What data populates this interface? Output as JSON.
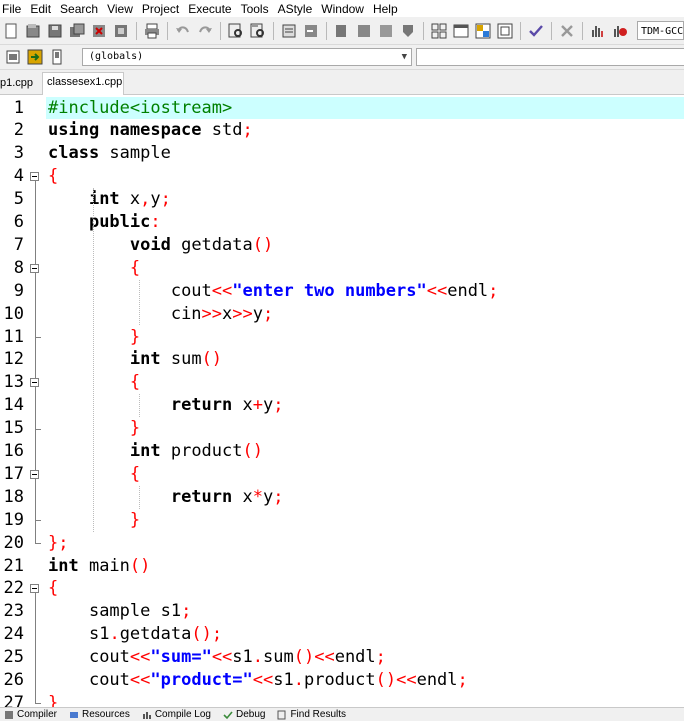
{
  "menubar": {
    "items": [
      "File",
      "Edit",
      "Search",
      "View",
      "Project",
      "Execute",
      "Tools",
      "AStyle",
      "Window",
      "Help"
    ]
  },
  "toolbar": {
    "compiler_label": "TDM-GCC"
  },
  "toolbar2": {
    "scope_value": "(globals)"
  },
  "tabs": [
    {
      "label": "p1.cpp"
    },
    {
      "label": "classesex1.cpp"
    }
  ],
  "editor": {
    "line_numbers": [
      "1",
      "2",
      "3",
      "4",
      "5",
      "6",
      "7",
      "8",
      "9",
      "10",
      "11",
      "12",
      "13",
      "14",
      "15",
      "16",
      "17",
      "18",
      "19",
      "20",
      "21",
      "22",
      "23",
      "24",
      "25",
      "26",
      "27"
    ],
    "lines": [
      [
        {
          "t": "#include<iostream>",
          "c": "pp"
        }
      ],
      [
        {
          "t": "using namespace ",
          "c": "kw"
        },
        {
          "t": "std",
          "c": "plain"
        },
        {
          "t": ";",
          "c": "sym"
        }
      ],
      [
        {
          "t": "class ",
          "c": "kw"
        },
        {
          "t": "sample",
          "c": "plain"
        }
      ],
      [
        {
          "t": "{",
          "c": "sym"
        }
      ],
      [
        {
          "t": "    ",
          "c": "plain"
        },
        {
          "t": "int ",
          "c": "kw"
        },
        {
          "t": "x",
          "c": "plain"
        },
        {
          "t": ",",
          "c": "sym"
        },
        {
          "t": "y",
          "c": "plain"
        },
        {
          "t": ";",
          "c": "sym"
        }
      ],
      [
        {
          "t": "    ",
          "c": "plain"
        },
        {
          "t": "public",
          "c": "kw"
        },
        {
          "t": ":",
          "c": "sym"
        }
      ],
      [
        {
          "t": "        ",
          "c": "plain"
        },
        {
          "t": "void ",
          "c": "kw"
        },
        {
          "t": "getdata",
          "c": "plain"
        },
        {
          "t": "()",
          "c": "sym"
        }
      ],
      [
        {
          "t": "        ",
          "c": "plain"
        },
        {
          "t": "{",
          "c": "sym"
        }
      ],
      [
        {
          "t": "            ",
          "c": "plain"
        },
        {
          "t": "cout",
          "c": "plain"
        },
        {
          "t": "<<",
          "c": "sym"
        },
        {
          "t": "\"enter two numbers\"",
          "c": "str"
        },
        {
          "t": "<<",
          "c": "sym"
        },
        {
          "t": "endl",
          "c": "plain"
        },
        {
          "t": ";",
          "c": "sym"
        }
      ],
      [
        {
          "t": "            ",
          "c": "plain"
        },
        {
          "t": "cin",
          "c": "plain"
        },
        {
          "t": ">>",
          "c": "sym"
        },
        {
          "t": "x",
          "c": "plain"
        },
        {
          "t": ">>",
          "c": "sym"
        },
        {
          "t": "y",
          "c": "plain"
        },
        {
          "t": ";",
          "c": "sym"
        }
      ],
      [
        {
          "t": "        ",
          "c": "plain"
        },
        {
          "t": "}",
          "c": "sym"
        }
      ],
      [
        {
          "t": "        ",
          "c": "plain"
        },
        {
          "t": "int ",
          "c": "kw"
        },
        {
          "t": "sum",
          "c": "plain"
        },
        {
          "t": "()",
          "c": "sym"
        }
      ],
      [
        {
          "t": "        ",
          "c": "plain"
        },
        {
          "t": "{",
          "c": "sym"
        }
      ],
      [
        {
          "t": "            ",
          "c": "plain"
        },
        {
          "t": "return ",
          "c": "kw"
        },
        {
          "t": "x",
          "c": "plain"
        },
        {
          "t": "+",
          "c": "sym"
        },
        {
          "t": "y",
          "c": "plain"
        },
        {
          "t": ";",
          "c": "sym"
        }
      ],
      [
        {
          "t": "        ",
          "c": "plain"
        },
        {
          "t": "}",
          "c": "sym"
        }
      ],
      [
        {
          "t": "        ",
          "c": "plain"
        },
        {
          "t": "int ",
          "c": "kw"
        },
        {
          "t": "product",
          "c": "plain"
        },
        {
          "t": "()",
          "c": "sym"
        }
      ],
      [
        {
          "t": "        ",
          "c": "plain"
        },
        {
          "t": "{",
          "c": "sym"
        }
      ],
      [
        {
          "t": "            ",
          "c": "plain"
        },
        {
          "t": "return ",
          "c": "kw"
        },
        {
          "t": "x",
          "c": "plain"
        },
        {
          "t": "*",
          "c": "sym"
        },
        {
          "t": "y",
          "c": "plain"
        },
        {
          "t": ";",
          "c": "sym"
        }
      ],
      [
        {
          "t": "        ",
          "c": "plain"
        },
        {
          "t": "}",
          "c": "sym"
        }
      ],
      [
        {
          "t": "};",
          "c": "sym"
        }
      ],
      [
        {
          "t": "int ",
          "c": "kw"
        },
        {
          "t": "main",
          "c": "plain"
        },
        {
          "t": "()",
          "c": "sym"
        }
      ],
      [
        {
          "t": "{",
          "c": "sym"
        }
      ],
      [
        {
          "t": "    ",
          "c": "plain"
        },
        {
          "t": "sample s1",
          "c": "plain"
        },
        {
          "t": ";",
          "c": "sym"
        }
      ],
      [
        {
          "t": "    ",
          "c": "plain"
        },
        {
          "t": "s1",
          "c": "plain"
        },
        {
          "t": ".",
          "c": "sym"
        },
        {
          "t": "getdata",
          "c": "plain"
        },
        {
          "t": "();",
          "c": "sym"
        }
      ],
      [
        {
          "t": "    ",
          "c": "plain"
        },
        {
          "t": "cout",
          "c": "plain"
        },
        {
          "t": "<<",
          "c": "sym"
        },
        {
          "t": "\"sum=\"",
          "c": "str"
        },
        {
          "t": "<<",
          "c": "sym"
        },
        {
          "t": "s1",
          "c": "plain"
        },
        {
          "t": ".",
          "c": "sym"
        },
        {
          "t": "sum",
          "c": "plain"
        },
        {
          "t": "()<<",
          "c": "sym"
        },
        {
          "t": "endl",
          "c": "plain"
        },
        {
          "t": ";",
          "c": "sym"
        }
      ],
      [
        {
          "t": "    ",
          "c": "plain"
        },
        {
          "t": "cout",
          "c": "plain"
        },
        {
          "t": "<<",
          "c": "sym"
        },
        {
          "t": "\"product=\"",
          "c": "str"
        },
        {
          "t": "<<",
          "c": "sym"
        },
        {
          "t": "s1",
          "c": "plain"
        },
        {
          "t": ".",
          "c": "sym"
        },
        {
          "t": "product",
          "c": "plain"
        },
        {
          "t": "()<<",
          "c": "sym"
        },
        {
          "t": "endl",
          "c": "plain"
        },
        {
          "t": ";",
          "c": "sym"
        }
      ],
      [
        {
          "t": "}",
          "c": "sym"
        }
      ]
    ]
  },
  "bottom_tabs": [
    {
      "label": "Compiler",
      "icon": "compiler-icon"
    },
    {
      "label": "Resources",
      "icon": "resources-icon"
    },
    {
      "label": "Compile Log",
      "icon": "compile-log-icon"
    },
    {
      "label": "Debug",
      "icon": "debug-icon"
    },
    {
      "label": "Find Results",
      "icon": "find-results-icon"
    }
  ],
  "colors": {
    "keyword": "#000000",
    "symbol": "#ff0000",
    "string": "#0000ff",
    "preprocessor": "#008000",
    "current_line": "#ccffff"
  }
}
